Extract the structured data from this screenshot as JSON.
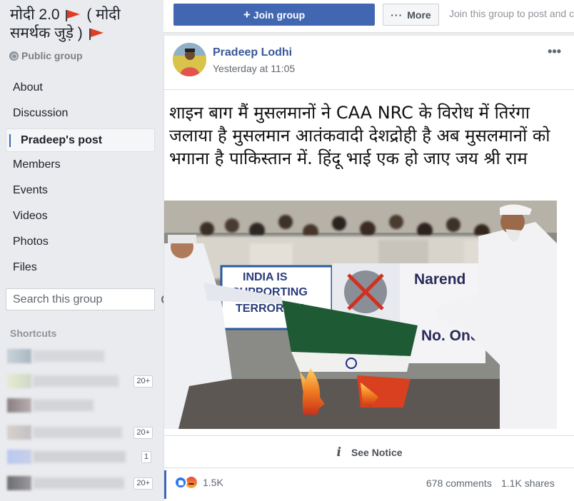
{
  "sidebar": {
    "group_title": {
      "part1": "मोदी 2.0",
      "part2": "( मोदी समर्थक जुड़े )"
    },
    "privacy_label": "Public group",
    "nav_items": [
      {
        "label": "About"
      },
      {
        "label": "Discussion"
      },
      {
        "label": "Pradeep's post",
        "active": true
      },
      {
        "label": "Members"
      },
      {
        "label": "Events"
      },
      {
        "label": "Videos"
      },
      {
        "label": "Photos"
      },
      {
        "label": "Files"
      }
    ],
    "search_placeholder": "Search this group",
    "shortcuts_title": "Shortcuts",
    "shortcut_badges": [
      "20+",
      "20+",
      "1",
      "20+"
    ]
  },
  "topbar": {
    "join_label": "Join group",
    "more_label": "More",
    "join_hint": "Join this group to post and co"
  },
  "post": {
    "author": "Pradeep Lodhi",
    "timestamp": "Yesterday at 11:05",
    "text": "शाइन बाग मैं मुसलमानों ने CAA NRC के विरोध में तिरंगा जलाया है मुसलमान आतंकवादी देशद्रोही है अब मुसलमानों को भगाना है पाकिस्तान में.  हिंदू भाई एक हो जाए जय श्री राम",
    "image_banner_left": "INDIA IS SUPPORTING TERRORISM",
    "image_banner_right": "Narendra ... No. One T...",
    "notice_label": "See Notice",
    "reaction_count": "1.5K",
    "comments": "678 comments",
    "shares": "1.1K shares"
  }
}
